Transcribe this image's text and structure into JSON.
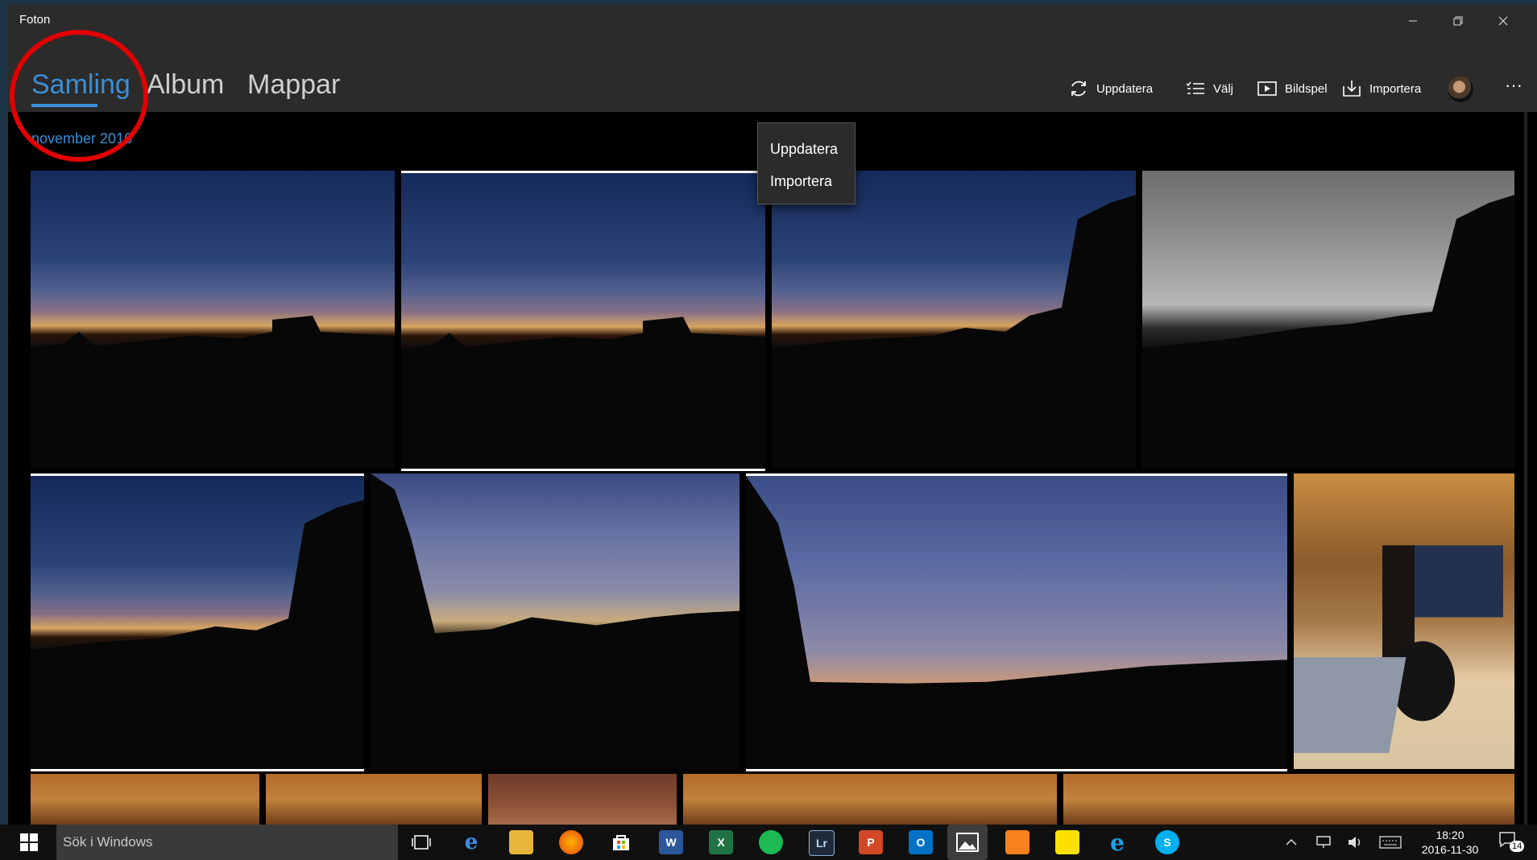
{
  "window": {
    "title": "Foton",
    "controls": [
      "minimize",
      "restore",
      "close"
    ]
  },
  "nav": {
    "tabs": [
      {
        "label": "Samling",
        "active": true
      },
      {
        "label": "Album",
        "active": false
      },
      {
        "label": "Mappar",
        "active": false
      }
    ]
  },
  "commands": {
    "refresh": "Uppdatera",
    "select": "Välj",
    "slideshow": "Bildspel",
    "import": "Importera",
    "more": "···"
  },
  "flyout": {
    "items": [
      "Uppdatera",
      "Importera"
    ]
  },
  "collection": {
    "date_header": "november 2016"
  },
  "colors": {
    "accent": "#3b8fd6",
    "annotation": "#e20000",
    "chrome": "#2b2b2b"
  },
  "taskbar": {
    "search_placeholder": "Sök i Windows",
    "time": "18:20",
    "date": "2016-11-30",
    "notification_count": "14",
    "apps": [
      "task-view",
      "edge",
      "file-explorer",
      "firefox",
      "store",
      "word",
      "excel",
      "spotify",
      "lightroom",
      "powerpoint",
      "outlook",
      "photos",
      "paint",
      "sticky-notes",
      "internet-explorer",
      "skype"
    ]
  }
}
